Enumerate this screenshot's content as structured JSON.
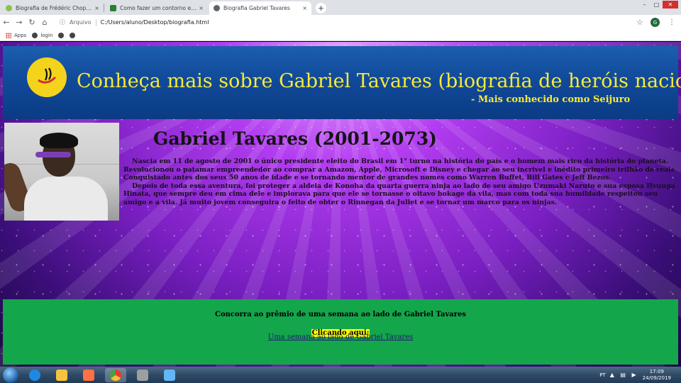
{
  "browser": {
    "tabs": [
      {
        "title": "Biografia de Frédéric Chopin - eBiografia",
        "favicon_color": "#8bc34a",
        "active": false
      },
      {
        "title": "Como fazer um contorno em texto",
        "favicon_color": "#2e7d32",
        "active": false
      },
      {
        "title": "Biografia Gabriel Tavares",
        "favicon_color": "#5f6368",
        "active": true
      }
    ],
    "close_glyph": "×",
    "new_tab_glyph": "+",
    "window": {
      "minimize": "–",
      "maximize": "□",
      "close": "✕"
    },
    "address": {
      "scheme_label": "Arquivo",
      "url": "C:/Users/aluno/Desktop/biografia.html"
    },
    "profile_initial": "G",
    "bookmarks": [
      {
        "label": "Apps",
        "icon": "apps-grid-icon"
      },
      {
        "label": "login",
        "icon": "globe-icon"
      },
      {
        "label": "",
        "icon": "globe-icon"
      },
      {
        "label": "",
        "icon": "globe-icon"
      }
    ]
  },
  "page": {
    "banner": {
      "title": "Conheça mais sobre Gabriel Tavares (biografia de heróis nacionais)",
      "subtitle": "- Mais conhecido como Seijuro"
    },
    "bio": {
      "heading": "Gabriel Tavares (2001-2073)",
      "paragraphs": [
        "Nascia em 11 de agosto de 2001 o único presidente eleito do Brasil em 1° turno na história do país e o homem mais rico da história do planeta. Revolucionou o patamar empreendedor ao comprar a Amazon, Apple, Microsoft e Disney e chegar ao seu incrivel e inédito primeiro trilhão de reais Conquistado antes dos seus 50 anos de idade e se tornando mentor de grandes nomes como Warren Buffet, Bill Gates e Jeff Bezos.",
        "Depois de toda essa aventura, foi proteger a aldeia de Konoha da quarta guerra ninja ao lado de seu amigo Uzumaki Naruto e sua esposa Hyuuga Hinata, que sempre deu em cima dele e implorava para que ele se tornasse o oitavo hokage da vila, mas com toda sua humildade respeitou seu amigo e a vila. Já muito jovem conseguira o feito de obter o Rinnegan da Juliet e se tornar um marco para os ninjas."
      ]
    },
    "footer": {
      "prize_text": "Concorra ao prêmio de uma semana ao lado de Gabriel Tavares",
      "click_label": "Clicando aqui:",
      "link_text": "Uma semana ao lado de Gabriel Tavares"
    }
  },
  "taskbar": {
    "apps": [
      {
        "name": "ie",
        "color": "#1e88e5"
      },
      {
        "name": "explorer",
        "color": "#f5c342"
      },
      {
        "name": "media",
        "color": "#ff7043"
      },
      {
        "name": "chrome",
        "color": "#e53935"
      },
      {
        "name": "app5",
        "color": "#9e9e9e"
      },
      {
        "name": "app6",
        "color": "#64b5f6"
      }
    ],
    "language": "PT",
    "time": "17:09",
    "date": "24/09/2019"
  },
  "colors": {
    "banner_text": "#f6ea3a",
    "footer_bg": "#14a64b",
    "highlight": "#ffff00"
  }
}
